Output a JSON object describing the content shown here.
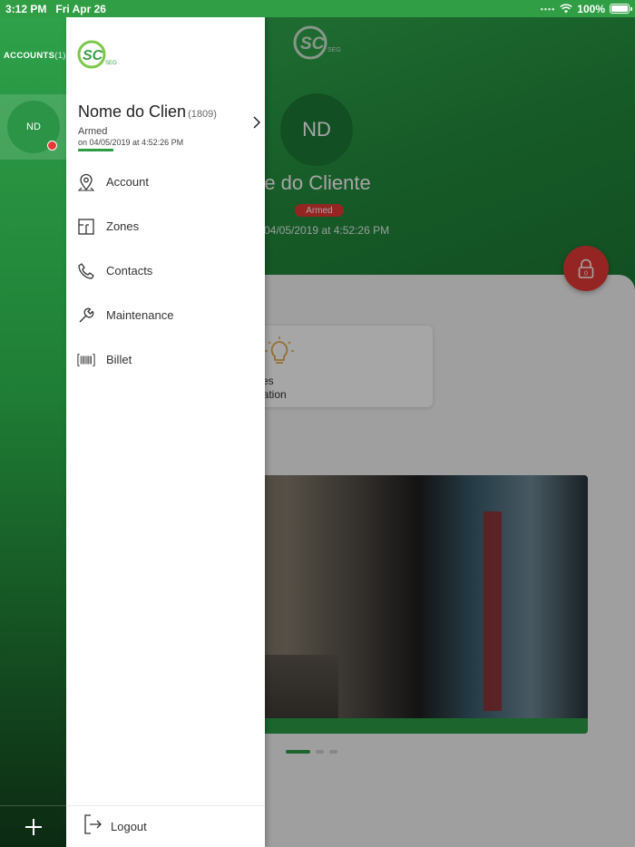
{
  "status_bar": {
    "time": "3:12 PM",
    "date": "Fri Apr 26",
    "battery": "100%"
  },
  "rail": {
    "title": "ACCOUNTS",
    "count": "(1)",
    "account_initials": "ND",
    "status_color": "#e53935"
  },
  "brand": {
    "logo_letters": "SC",
    "logo_sub": "SEG",
    "primary_color": "#2c9d45",
    "alert_color": "#e53935"
  },
  "drawer": {
    "profile": {
      "name": "Nome do Clien",
      "id": "(1809)",
      "state": "Armed",
      "date": "on 04/05/2019 at 4:52:26 PM"
    },
    "menu": [
      {
        "label": "Account",
        "icon": "map-pin-icon"
      },
      {
        "label": "Zones",
        "icon": "floorplan-icon"
      },
      {
        "label": "Contacts",
        "icon": "phone-icon"
      },
      {
        "label": "Maintenance",
        "icon": "wrench-icon"
      },
      {
        "label": "Billet",
        "icon": "barcode-icon"
      }
    ],
    "logout_label": "Logout"
  },
  "background": {
    "avatar_initials": "ND",
    "client_name": "me do Cliente",
    "state_badge": "Armed",
    "date": "04/05/2019 at 4:52:26 PM",
    "tile_line1": "ces",
    "tile_line2": "nation"
  }
}
